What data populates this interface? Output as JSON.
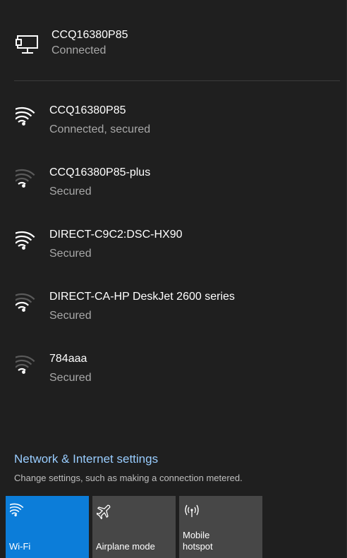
{
  "ethernet": {
    "name": "CCQ16380P85",
    "status": "Connected"
  },
  "networks": [
    {
      "name": "CCQ16380P85",
      "status": "Connected, secured",
      "signal": "full"
    },
    {
      "name": "CCQ16380P85-plus",
      "status": "Secured",
      "signal": "weak"
    },
    {
      "name": "DIRECT-C9C2:DSC-HX90",
      "status": "Secured",
      "signal": "full"
    },
    {
      "name": "DIRECT-CA-HP DeskJet 2600 series",
      "status": "Secured",
      "signal": "medium"
    },
    {
      "name": "784aaa",
      "status": "Secured",
      "signal": "weak"
    }
  ],
  "settings": {
    "link": "Network & Internet settings",
    "description": "Change settings, such as making a connection metered."
  },
  "tiles": [
    {
      "label": "Wi-Fi",
      "icon": "wifi-icon",
      "active": true
    },
    {
      "label": "Airplane mode",
      "icon": "airplane-icon",
      "active": false
    },
    {
      "label": "Mobile\nhotspot",
      "icon": "hotspot-icon",
      "active": false
    }
  ],
  "colors": {
    "background": "#1f1f1f",
    "accent": "#0c7dd9",
    "link": "#99cdff",
    "secondary_text": "#a8a8a8",
    "tile": "#474747"
  }
}
